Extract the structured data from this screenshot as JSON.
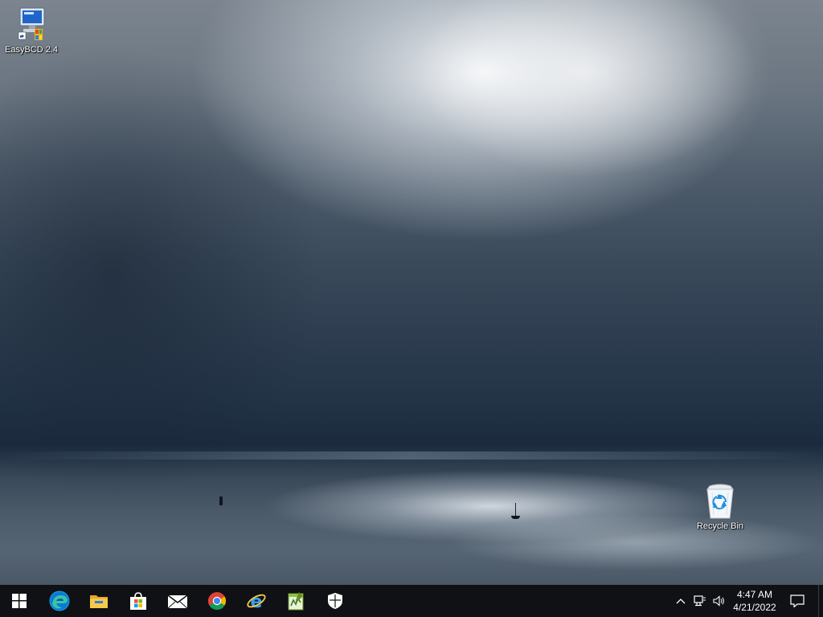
{
  "desktop": {
    "icons": [
      {
        "label": "EasyBCD 2.4"
      },
      {
        "label": "Recycle Bin"
      }
    ]
  },
  "taskbar": {
    "pinned_apps": [
      {
        "icon": "windows-start-icon"
      },
      {
        "icon": "edge-icon"
      },
      {
        "icon": "file-explorer-icon"
      },
      {
        "icon": "microsoft-store-icon"
      },
      {
        "icon": "mail-icon"
      },
      {
        "icon": "chrome-icon"
      },
      {
        "icon": "internet-explorer-icon"
      },
      {
        "icon": "notepad-plus-plus-icon"
      },
      {
        "icon": "windows-security-icon"
      }
    ],
    "tray": {
      "icons": [
        "chevron-up-icon",
        "network-icon",
        "volume-icon"
      ],
      "time": "4:47 AM",
      "date": "4/21/2022"
    },
    "colors": {
      "background": "#0f1114",
      "text": "#ffffff"
    }
  }
}
